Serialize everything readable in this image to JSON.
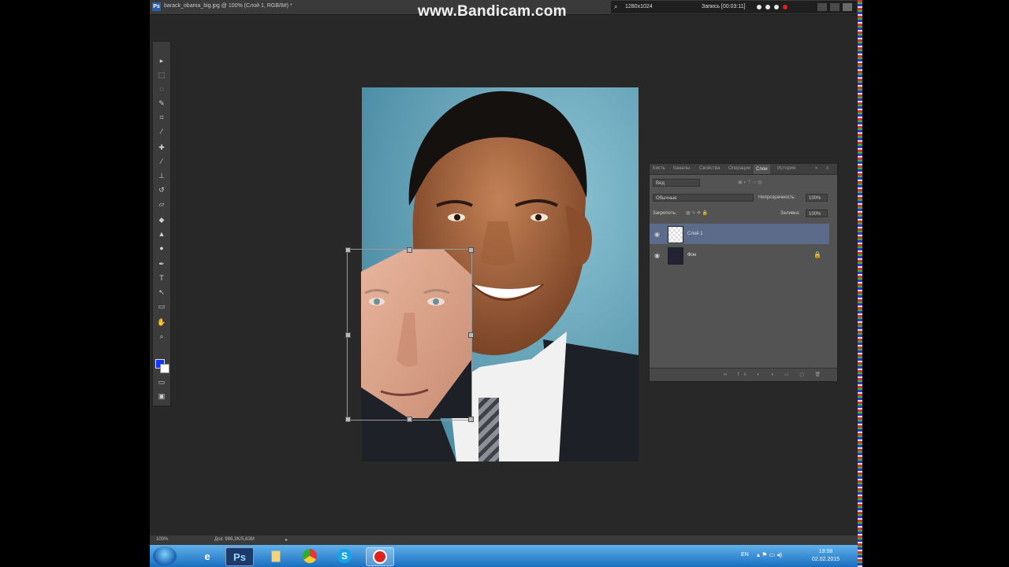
{
  "window": {
    "title": "barack_obama_big.jpg @ 100% (Слой 1, RGB/8#) *",
    "watermark": "www.Bandicam.com"
  },
  "recorder": {
    "resolution": "1280x1024",
    "recording_label": "Запись [00:03:11]"
  },
  "toolbar": {
    "tools": [
      "move-tool",
      "marquee-tool",
      "lasso-tool",
      "quick-select-tool",
      "crop-tool",
      "eyedropper-tool",
      "healing-brush-tool",
      "brush-tool",
      "clone-stamp-tool",
      "history-brush-tool",
      "eraser-tool",
      "paint-bucket-tool",
      "blur-tool",
      "dodge-tool",
      "pen-tool",
      "type-tool",
      "path-select-tool",
      "shape-tool",
      "hand-tool",
      "zoom-tool"
    ],
    "foreground_color": "#1236ff",
    "background_color": "#ffffff"
  },
  "layers_panel": {
    "tabs": [
      "Кисть",
      "Каналы",
      "Свойства",
      "Операции",
      "Слои",
      "История"
    ],
    "active_tab": "Слои",
    "filter_label": "Вид",
    "blend_mode": "Обычные",
    "opacity_label": "Непрозрачность:",
    "opacity_value": "100%",
    "lock_label": "Закрепить:",
    "fill_label": "Заливка:",
    "fill_value": "100%",
    "layers": [
      {
        "name": "Слой 1",
        "selected": true
      },
      {
        "name": "Фон",
        "selected": false,
        "locked": true
      }
    ]
  },
  "statusbar": {
    "zoom": "100%",
    "doc_size": "Док: 986,3K/5,63M"
  },
  "taskbar": {
    "apps": [
      "ie-icon",
      "photoshop-icon",
      "folder-icon",
      "chrome-icon",
      "skype-icon",
      "bandicam-icon"
    ],
    "language": "EN",
    "time": "19:58",
    "date": "02.02.2015"
  }
}
